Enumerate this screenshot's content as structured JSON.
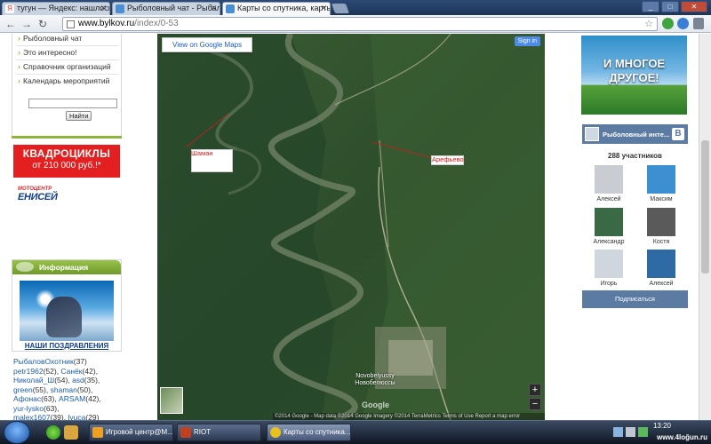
{
  "browser": {
    "tabs": [
      {
        "label": "тугун — Яндекс: нашлось",
        "icon": "yandex-icon"
      },
      {
        "label": "Рыболовный чат - Рыбалк",
        "icon": "fish-icon"
      },
      {
        "label": "Карты со спутника, карты",
        "icon": "fish-icon"
      }
    ],
    "url_host": "www.bylkov.ru",
    "url_path": "/index/0-53"
  },
  "left_menu": {
    "items": [
      "Рыболовный чат",
      "Это интересно!",
      "Справочник организаций",
      "Календарь мероприятий"
    ],
    "search_button": "Найти"
  },
  "ad_quad": {
    "line1": "КВАДРОЦИКЛЫ",
    "line2": "от 210 000 руб.!*"
  },
  "logo_moto": {
    "top": "МОТОЦЕНТР",
    "bottom": "ЕНИСЕЙ"
  },
  "info": {
    "header": "Информация",
    "caption": "НАШИ ПОЗДРАВЛЕНИЯ",
    "users": [
      {
        "name": "РыбаловОхотник",
        "count": "(37)"
      },
      {
        "name": "petr1962",
        "count": "(52)"
      },
      {
        "name": "Санёк",
        "count": "(42)"
      },
      {
        "name": "Николай_Ш",
        "count": "(54)"
      },
      {
        "name": "asd",
        "count": "(35)"
      },
      {
        "name": "green",
        "count": "(55)"
      },
      {
        "name": "shaman",
        "count": "(50)"
      },
      {
        "name": "Афонас",
        "count": "(63)"
      },
      {
        "name": "ARSAM",
        "count": "(42)"
      },
      {
        "name": "yur-lysko",
        "count": "(63)"
      },
      {
        "name": "malex1607",
        "count": "(39)"
      },
      {
        "name": "lyuca",
        "count": "(29)"
      }
    ]
  },
  "map": {
    "view_button": "View on Google Maps",
    "signin": "Sign in",
    "label_left": "Шаман",
    "label_right": "Арефьево",
    "place": "Novobelyussy",
    "place_ru": "Новобелюссы",
    "zoom_in": "+",
    "zoom_out": "−",
    "google": "Google",
    "copyright": "©2014 Google - Map data ©2014 Google Imagery ©2014 TerraMetrics   Terms of Use   Report a map error"
  },
  "right": {
    "ad_text_1": "И МНОГОЕ",
    "ad_text_2": "ДРУГОЕ!",
    "vk_title": "Рыболовный инте...",
    "vk_logo": "B",
    "members_count": "288 участников",
    "members": [
      {
        "name": "Алексей",
        "color": "#c9cdd3"
      },
      {
        "name": "Максим",
        "color": "#3c8fd0"
      },
      {
        "name": "Александр",
        "color": "#3a6a45"
      },
      {
        "name": "Костя",
        "color": "#5a5a5a"
      },
      {
        "name": "Игорь",
        "color": "#d0d6de"
      },
      {
        "name": "Алексей",
        "color": "#2e6aa4"
      }
    ],
    "subscribe": "Подписаться"
  },
  "taskbar": {
    "tasks": [
      {
        "label": "Игровой центр@M...",
        "icon": "mail-icon",
        "color": "#f0a020"
      },
      {
        "label": "RIOT",
        "icon": "game-icon",
        "color": "#c04020"
      },
      {
        "label": "Карты со спутника...",
        "icon": "chrome-icon",
        "color": "#e8c020"
      }
    ],
    "clock": "13:20",
    "watermark": "www.4loğun.ru"
  },
  "colors": {
    "accent_green": "#8db63a",
    "vk_blue": "#5b7ba3",
    "ad_red": "#e41f1f"
  }
}
